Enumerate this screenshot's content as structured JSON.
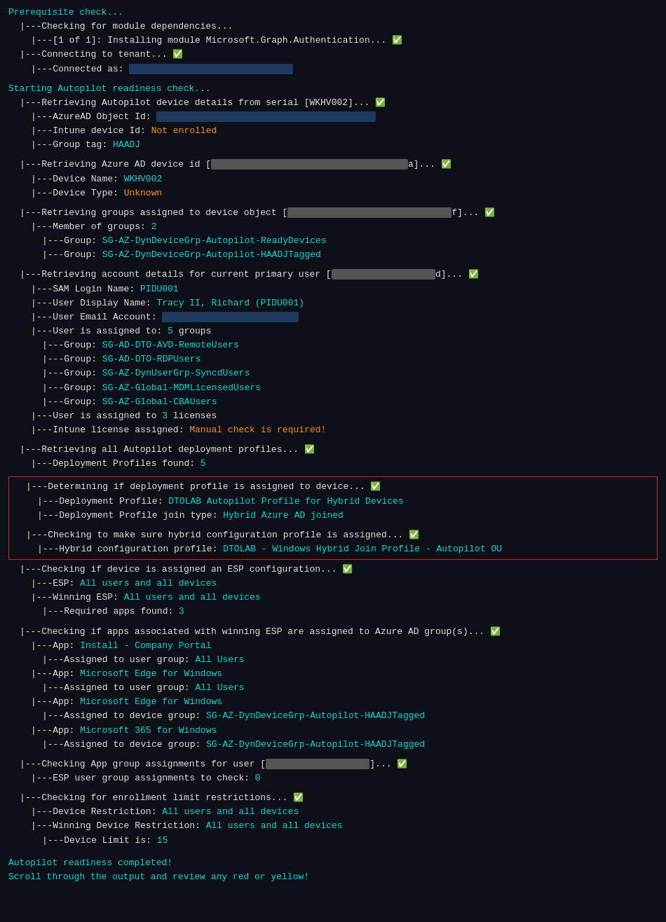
{
  "terminal": {
    "lines": []
  }
}
